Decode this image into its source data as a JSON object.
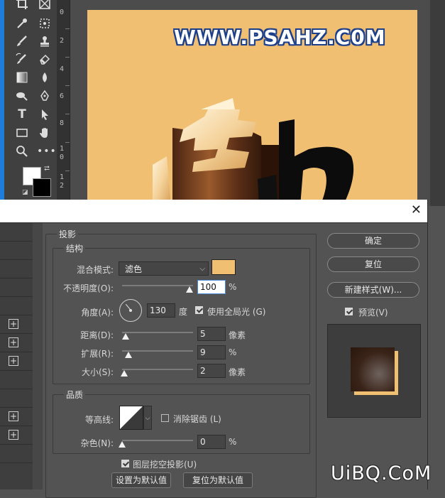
{
  "ruler": {
    "marks": [
      "0",
      "2",
      "4",
      "6",
      "8",
      "1",
      "0",
      "1",
      "2"
    ]
  },
  "canvas": {
    "watermark": "WWW.PSAHZ.C0M",
    "background": "#f1bf72"
  },
  "dialog": {
    "section_title": "投影",
    "structure": {
      "title": "结构",
      "blend_mode_label": "混合模式:",
      "blend_mode_value": "滤色",
      "shadow_color": "#f1bf72",
      "opacity_label": "不透明度(O):",
      "opacity_value": "100",
      "opacity_unit": "%",
      "angle_label": "角度(A):",
      "angle_value": "130",
      "angle_unit": "度",
      "global_light_label": "使用全局光 (G)",
      "global_light_checked": true,
      "distance_label": "距离(D):",
      "distance_value": "5",
      "distance_unit": "像素",
      "spread_label": "扩展(R):",
      "spread_value": "9",
      "spread_unit": "%",
      "size_label": "大小(S):",
      "size_value": "2",
      "size_unit": "像素"
    },
    "quality": {
      "title": "品质",
      "contour_label": "等高线:",
      "antialias_label": "消除锯齿 (L)",
      "antialias_checked": false,
      "noise_label": "杂色(N):",
      "noise_value": "0",
      "noise_unit": "%"
    },
    "knockout_label": "图层挖空投影(U)",
    "knockout_checked": true,
    "set_default_label": "设置为默认值",
    "reset_default_label": "复位为默认值",
    "buttons": {
      "ok": "确定",
      "reset": "复位",
      "new_style": "新建样式(W)..."
    },
    "preview_label": "预览(V)",
    "preview_checked": true
  },
  "site_logo": "UiBQ.CoM"
}
